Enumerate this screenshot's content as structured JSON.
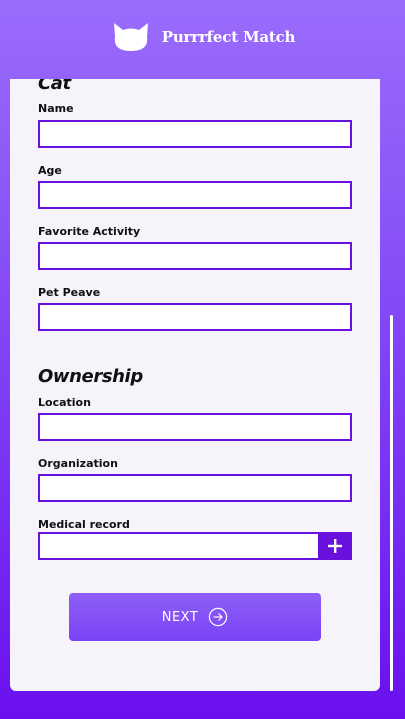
{
  "header": {
    "brand_name": "Purrrfect Match",
    "logo_icon": "cat-head-icon"
  },
  "form": {
    "cat_section": {
      "title": "Cat",
      "fields": [
        {
          "label": "Name",
          "value": ""
        },
        {
          "label": "Age",
          "value": ""
        },
        {
          "label": "Favorite Activity",
          "value": ""
        },
        {
          "label": "Pet Peave",
          "value": ""
        }
      ]
    },
    "ownership_section": {
      "title": "Ownership",
      "fields": [
        {
          "label": "Location",
          "value": ""
        },
        {
          "label": "Organization",
          "value": ""
        },
        {
          "label": "Medical record",
          "value": ""
        }
      ],
      "add_icon": "plus-icon"
    },
    "next_button": {
      "label": "NEXT",
      "icon": "arrow-right-circle-icon"
    }
  },
  "colors": {
    "accent": "#6a12dd",
    "button": "#8d5ff7",
    "card_bg": "#f6f3fb"
  }
}
